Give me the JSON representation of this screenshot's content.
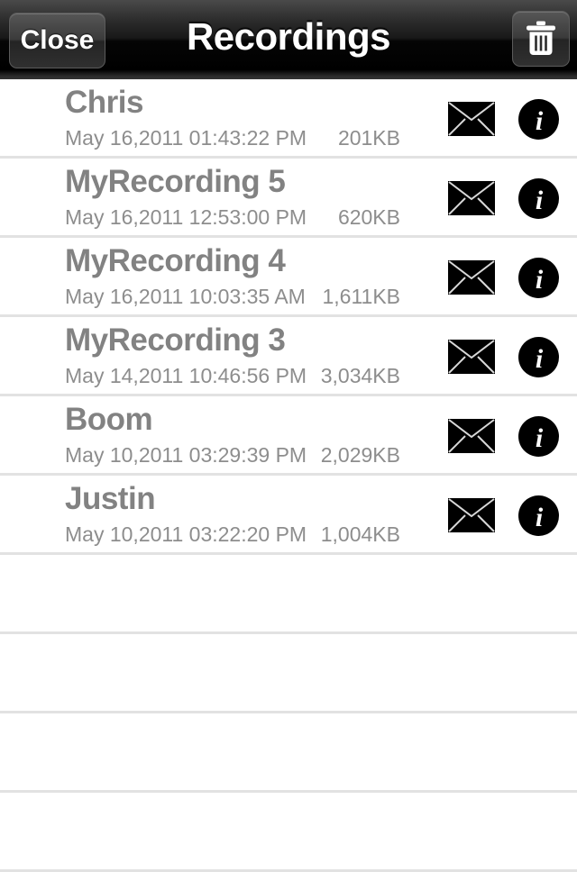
{
  "navbar": {
    "title": "Recordings",
    "close_label": "Close",
    "trash_icon": "trash-icon",
    "background_color": "#000000",
    "title_color": "#ffffff"
  },
  "list": {
    "separator_color": "#e2e2e2",
    "title_color": "#828282",
    "meta_color": "#8d8d8d",
    "mail_icon": "mail-envelope-icon",
    "info_icon": "info-circle-icon",
    "rows": [
      {
        "name": "Chris",
        "date": "May 16,2011 01:43:22 PM",
        "size": "201KB"
      },
      {
        "name": "MyRecording 5",
        "date": "May 16,2011 12:53:00 PM",
        "size": "620KB"
      },
      {
        "name": "MyRecording 4",
        "date": "May 16,2011 10:03:35 AM",
        "size": "1,611KB"
      },
      {
        "name": "MyRecording 3",
        "date": "May 14,2011 10:46:56 PM",
        "size": "3,034KB"
      },
      {
        "name": "Boom",
        "date": "May 10,2011 03:29:39 PM",
        "size": "2,029KB"
      },
      {
        "name": "Justin",
        "date": "May 10,2011 03:22:20 PM",
        "size": "1,004KB"
      }
    ],
    "empty_row_count": 4
  }
}
